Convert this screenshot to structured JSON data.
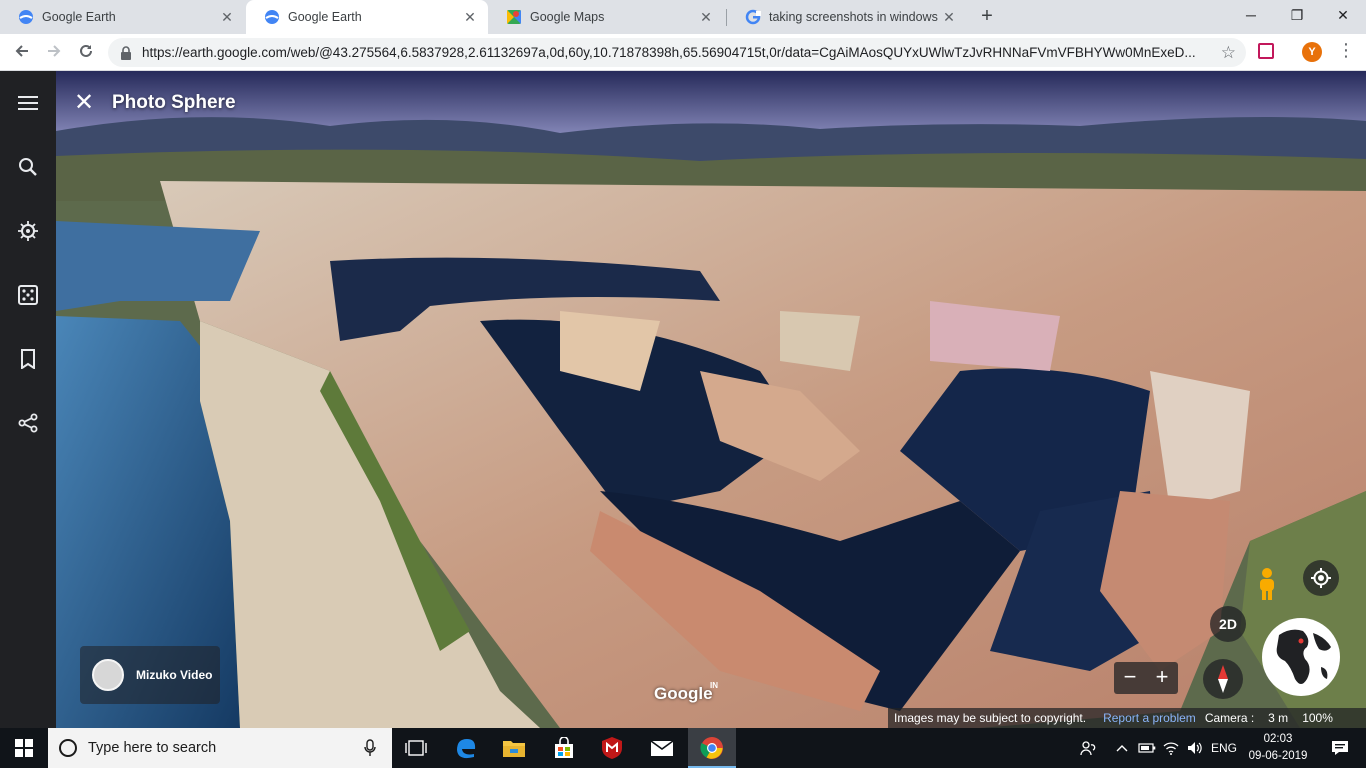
{
  "browser": {
    "tabs": [
      {
        "title": "Google Earth",
        "favicon": "google-earth-icon",
        "active": false
      },
      {
        "title": "Google Earth",
        "favicon": "google-earth-icon",
        "active": true
      },
      {
        "title": "Google Maps",
        "favicon": "google-maps-icon",
        "active": false
      },
      {
        "title": "taking screenshots in windows 10",
        "favicon": "google-g-icon",
        "active": false
      }
    ],
    "tab_close": "✕",
    "new_tab": "+",
    "window_controls": {
      "minimize": "─",
      "restore": "❐",
      "close": "✕"
    },
    "url": "https://earth.google.com/web/@43.275564,6.5837928,2.61132697a,0d,60y,10.71878398h,65.56904715t,0r/data=CgAiMAosQUYxUWlwTzJvRHNNaFVmVFBHYWw0MnExeD...",
    "profile_initial": "Y"
  },
  "earth": {
    "panel_title": "Photo Sphere",
    "close_label": "✕",
    "sidebar_icons": [
      "menu-icon",
      "search-icon",
      "voyager-icon",
      "feeling-lucky-icon",
      "projects-icon",
      "share-icon"
    ],
    "author": "Mizuko Video",
    "google_logo": "Google",
    "google_region": "IN",
    "btn_2d": "2D",
    "zoom_out": "−",
    "zoom_in": "+",
    "status": {
      "copyright": "Images may be subject to copyright.",
      "report": "Report a problem",
      "camera_label": "Camera :",
      "camera_value": "3 m",
      "zoom": "100%"
    }
  },
  "taskbar": {
    "search_placeholder": "Type here to search",
    "apps": [
      "task-view-icon",
      "edge-icon",
      "file-explorer-icon",
      "store-icon",
      "mcafee-icon",
      "mail-icon",
      "chrome-icon"
    ],
    "language": "ENG",
    "time": "02:03",
    "date": "09-06-2019"
  },
  "colors": {
    "sidebar": "#202124",
    "link": "#8ab4f8",
    "water": "#1b2a4a",
    "accent_taskbar": "#76b9ed"
  }
}
